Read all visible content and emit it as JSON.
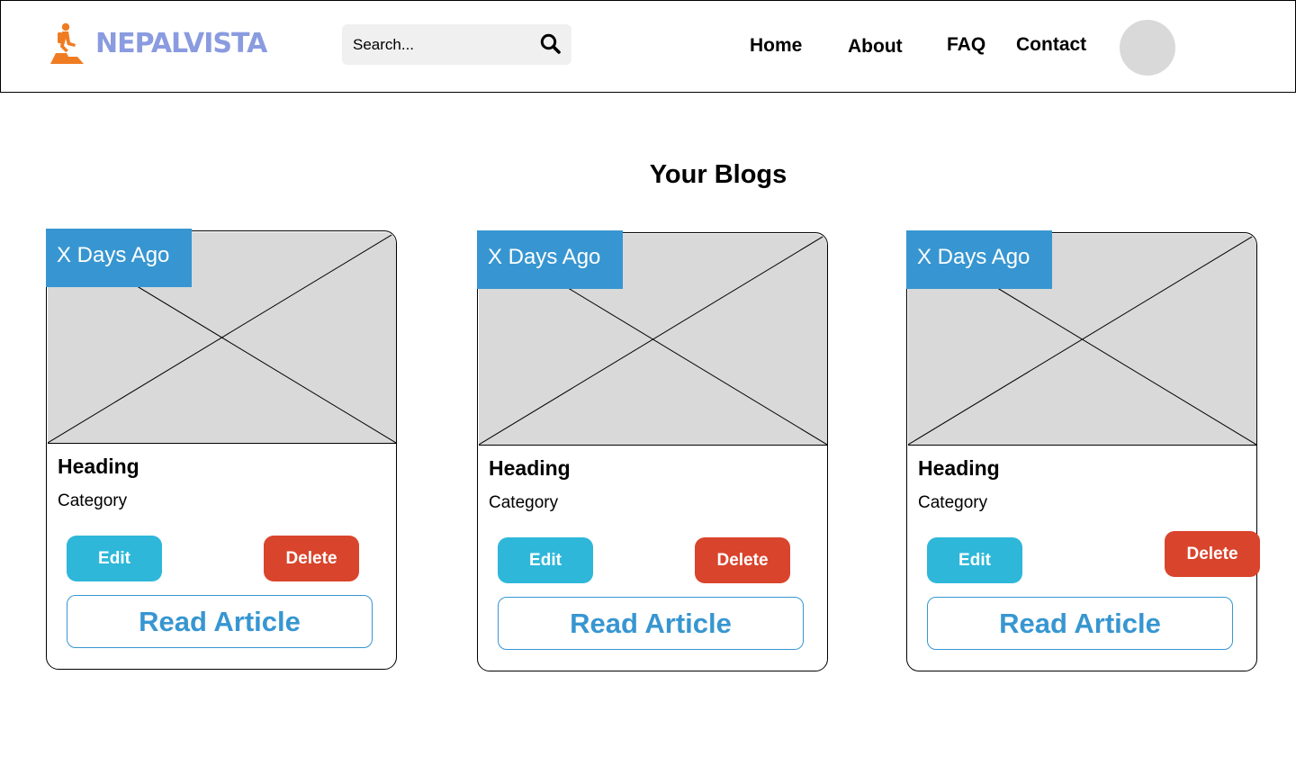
{
  "header": {
    "logo_text": "NEPALVISTA",
    "search_placeholder": "Search...",
    "nav": [
      "Home",
      "About",
      "FAQ",
      "Contact"
    ]
  },
  "main": {
    "title": "Your Blogs",
    "cards": [
      {
        "badge": "X Days Ago",
        "heading": "Heading",
        "category": "Category",
        "edit": "Edit",
        "delete": "Delete",
        "read": "Read Article"
      },
      {
        "badge": "X Days Ago",
        "heading": "Heading",
        "category": "Category",
        "edit": "Edit",
        "delete": "Delete",
        "read": "Read Article"
      },
      {
        "badge": "X Days Ago",
        "heading": "Heading",
        "category": "Category",
        "edit": "Edit",
        "delete": "Delete",
        "read": "Read Article"
      }
    ]
  },
  "icons": {
    "logo": "hiker-icon",
    "search": "search-icon",
    "image_placeholder": "image-placeholder-icon"
  },
  "colors": {
    "logo_text": "#8a9be0",
    "logo_icon": "#f07c22",
    "badge": "#3796d1",
    "edit_button": "#2eb7d9",
    "delete_button": "#d9442c",
    "read_button_border": "#3796d1",
    "placeholder": "#d9d9d9",
    "search_bg": "#f0f0f0"
  }
}
